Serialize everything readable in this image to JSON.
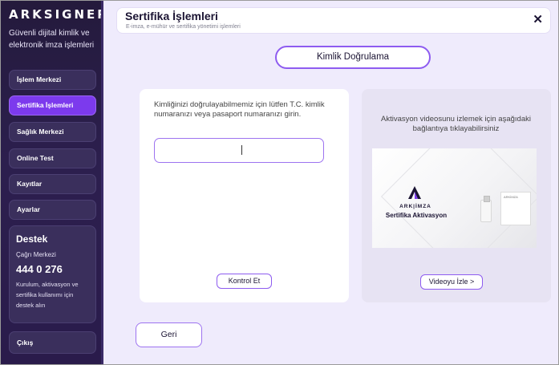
{
  "app": {
    "logo": "ARKSIGNER",
    "tagline": "Güvenli dijital kimlik ve elektronik imza işlemleri"
  },
  "sidebar": {
    "items": [
      {
        "label": "İşlem Merkezi",
        "active": false
      },
      {
        "label": "Sertifika İşlemleri",
        "active": true
      },
      {
        "label": "Sağlık Merkezi",
        "active": false
      },
      {
        "label": "Online Test",
        "active": false
      },
      {
        "label": "Kayıtlar",
        "active": false
      },
      {
        "label": "Ayarlar",
        "active": false
      }
    ],
    "support": {
      "title": "Destek",
      "subtitle": "Çağrı Merkezi",
      "phone": "444 0 276",
      "description": "Kurulum, aktivasyon ve sertifika kullanımı için destek alın"
    },
    "logout_label": "Çıkış"
  },
  "header": {
    "title": "Sertifika İşlemleri",
    "subtitle": "E-imza, e-mühür ve sertifika yönetimi işlemleri",
    "close_icon": "close-icon"
  },
  "main": {
    "section_title": "Kimlik Doğrulama",
    "identity": {
      "instruction": "Kimliğinizi doğrulayabilmemiz için lütfen T.C. kimlik numaranızı veya pasaport numaranızı girin.",
      "input_value": "",
      "input_placeholder": "",
      "check_button": "Kontrol Et"
    },
    "video": {
      "instruction": "Aktivasyon videosunu izlemek için aşağıdaki bağlantıya tıklayabilirsiniz",
      "brand": "ARK|İMZA",
      "caption": "Sertifika Aktivasyon",
      "box_label": "ARKİMZA",
      "watch_button": "Videoyu İzle >"
    },
    "back_button": "Geri"
  },
  "colors": {
    "sidebar_bg": "#2a1b4b",
    "accent": "#7c3aed",
    "main_bg": "#efebfc"
  }
}
